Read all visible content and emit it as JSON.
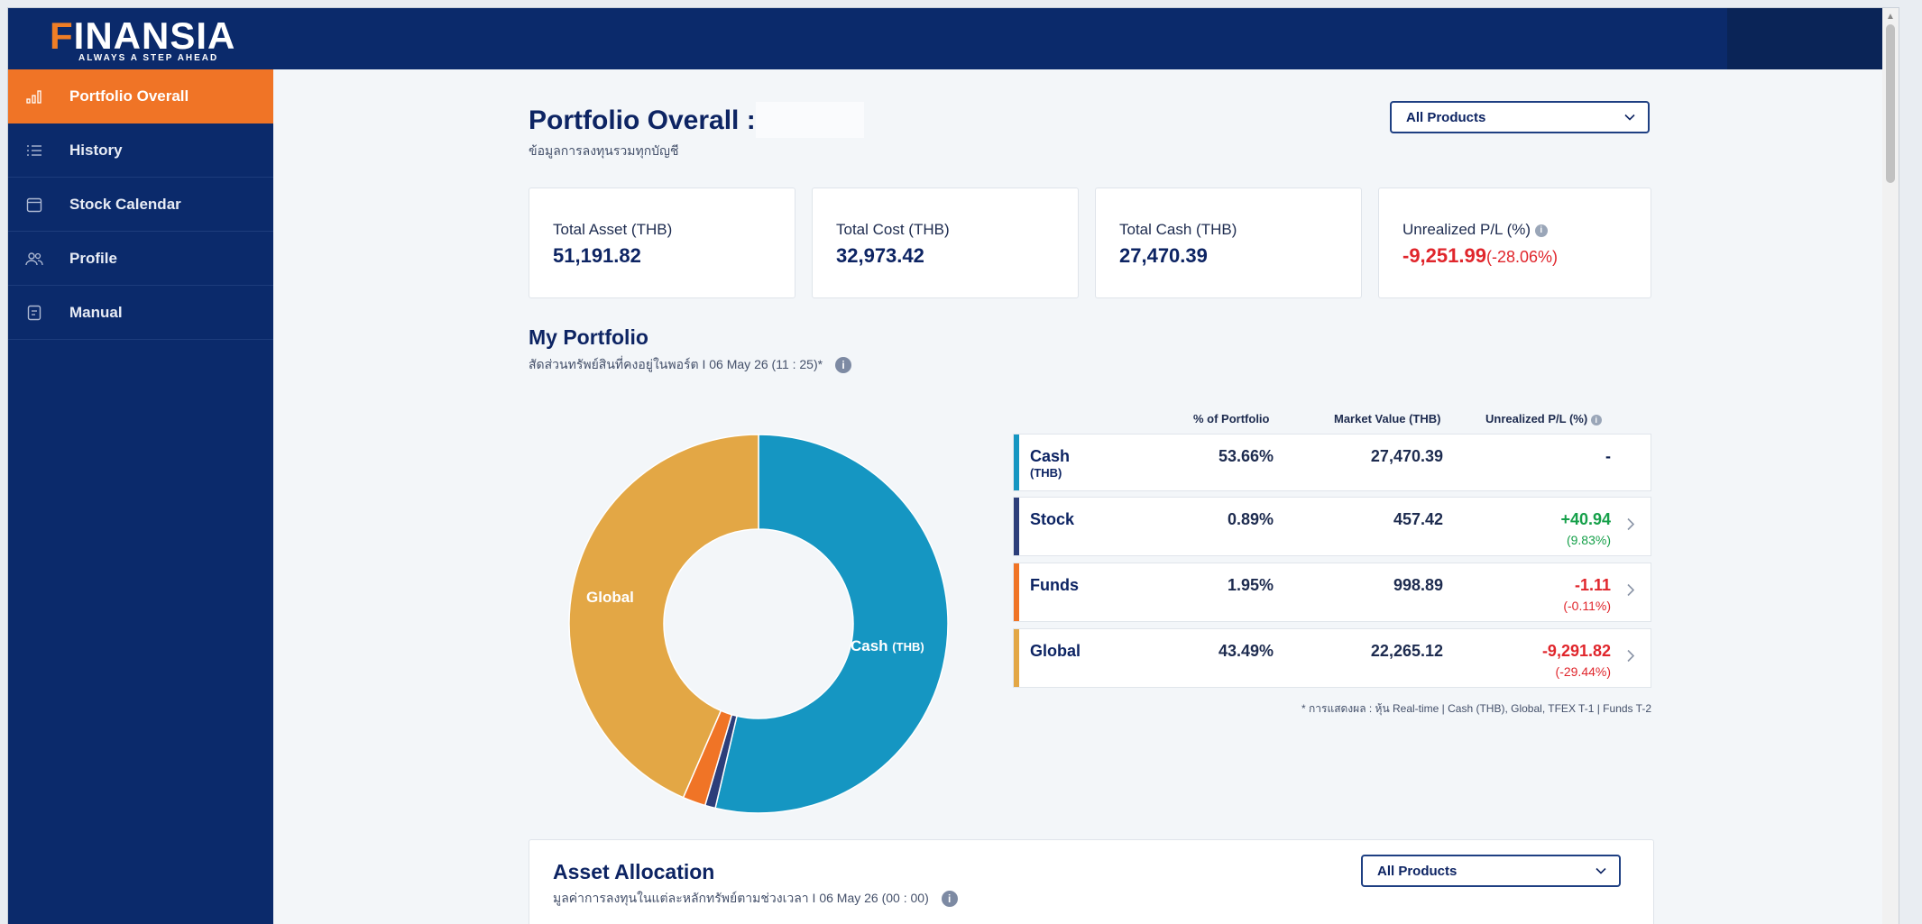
{
  "brand": {
    "name": "INANSIA",
    "first_letter": "F",
    "tagline": "ALWAYS A STEP AHEAD"
  },
  "sidebar": {
    "items": [
      {
        "label": "Portfolio Overall",
        "icon": "chart-bars-icon",
        "active": true
      },
      {
        "label": "History",
        "icon": "list-icon"
      },
      {
        "label": "Stock Calendar",
        "icon": "calendar-icon"
      },
      {
        "label": "Profile",
        "icon": "users-icon"
      },
      {
        "label": "Manual",
        "icon": "document-icon"
      }
    ]
  },
  "header": {
    "title": "Portfolio Overall :",
    "subtitle": "ข้อมูลการลงทุนรวมทุกบัญชี",
    "product_filter": "All Products"
  },
  "summary": {
    "total_asset": {
      "label": "Total Asset (THB)",
      "value": "51,191.82"
    },
    "total_cost": {
      "label": "Total Cost (THB)",
      "value": "32,973.42"
    },
    "total_cash": {
      "label": "Total Cash (THB)",
      "value": "27,470.39"
    },
    "unrealized": {
      "label": "Unrealized P/L (%)",
      "value": "-9,251.99",
      "percent": "(-28.06%)"
    }
  },
  "my_portfolio": {
    "title": "My Portfolio",
    "subtitle": "สัดส่วนทรัพย์สินที่คงอยู่ในพอร์ต I 06 May 26 (11 : 25)*",
    "columns": {
      "pct": "% of Portfolio",
      "mv": "Market Value (THB)",
      "pl": "Unrealized P/L (%)"
    },
    "rows": [
      {
        "name": "Cash",
        "sub": "(THB)",
        "pct": "53.66%",
        "mv": "27,470.39",
        "pl": "-",
        "pl_pct": "",
        "color": "#1596c2"
      },
      {
        "name": "Stock",
        "sub": "",
        "pct": "0.89%",
        "mv": "457.42",
        "pl": "+40.94",
        "pl_pct": "(9.83%)",
        "color": "#2c3e7a"
      },
      {
        "name": "Funds",
        "sub": "",
        "pct": "1.95%",
        "mv": "998.89",
        "pl": "-1.11",
        "pl_pct": "(-0.11%)",
        "color": "#f07426"
      },
      {
        "name": "Global",
        "sub": "",
        "pct": "43.49%",
        "mv": "22,265.12",
        "pl": "-9,291.82",
        "pl_pct": "(-29.44%)",
        "color": "#e3a745"
      }
    ],
    "footnote": "* การแสดงผล : หุ้น Real-time | Cash (THB), Global, TFEX T-1 | Funds T-2",
    "donut_labels": {
      "cash": "Cash",
      "cash_unit": "(THB)",
      "global": "Global"
    }
  },
  "chart_data": {
    "type": "pie",
    "categories": [
      "Cash (THB)",
      "Stock",
      "Funds",
      "Global"
    ],
    "values": [
      53.66,
      0.89,
      1.95,
      43.49
    ],
    "colors": [
      "#1596c2",
      "#2c3e7a",
      "#f07426",
      "#e3a745"
    ],
    "donut": true
  },
  "asset_allocation": {
    "title": "Asset Allocation",
    "subtitle": "มูลค่าการลงทุนในแต่ละหลักทรัพย์ตามช่วงเวลา I 06 May 26 (00 : 00)",
    "product_filter": "All Products"
  }
}
